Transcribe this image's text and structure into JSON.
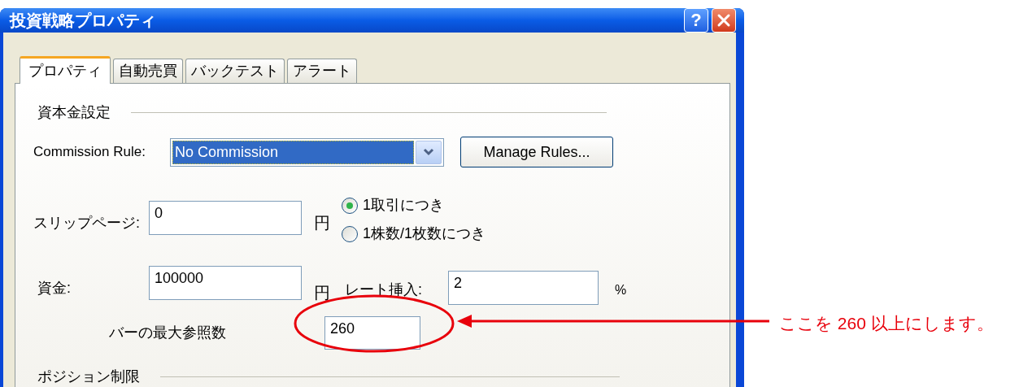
{
  "window": {
    "title": "投資戦略プロパティ",
    "help_button": "?"
  },
  "tabs": [
    {
      "label": "プロパティ",
      "selected": true
    },
    {
      "label": "自動売買",
      "selected": false
    },
    {
      "label": "バックテスト",
      "selected": false
    },
    {
      "label": "アラート",
      "selected": false
    }
  ],
  "capital_section": {
    "title": "資本金設定"
  },
  "commission_rule": {
    "label": "Commission Rule:",
    "value": "No Commission",
    "highlighted": true
  },
  "manage_rules_button": "Manage Rules...",
  "slippage": {
    "label": "スリップページ:",
    "value": "0",
    "unit": "円"
  },
  "slippage_mode": [
    {
      "label": "1取引につき",
      "selected": true
    },
    {
      "label": "1株数/1枚数につき",
      "selected": false
    }
  ],
  "capital": {
    "label": "資金:",
    "value": "100000",
    "unit": "円"
  },
  "rate": {
    "label": "レート挿入:",
    "value": "2",
    "unit": "%"
  },
  "max_bars": {
    "label": "バーの最大参照数",
    "value": "260"
  },
  "position_section": {
    "title": "ポジション制限"
  },
  "annotation": {
    "text": "ここを 260 以上にします。"
  }
}
